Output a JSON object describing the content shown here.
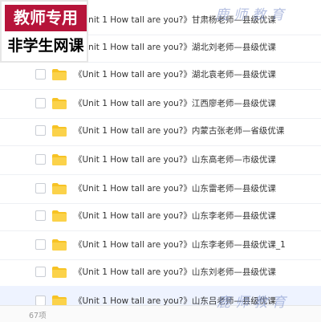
{
  "badge": {
    "line1": "教师专用",
    "line2": "非学生网课",
    "colors": {
      "top_bg": "#b6143a",
      "top_text": "#ffffff"
    }
  },
  "watermark": {
    "text": "鹿师教育"
  },
  "files": [
    {
      "name": "《Unit 1 How tall are you?》甘肃杨老师—县级优课",
      "icon": "folder-icon"
    },
    {
      "name": "《Unit 1 How tall are you?》湖北刘老师—县级优课",
      "icon": "folder-icon"
    },
    {
      "name": "《Unit 1 How tall are you?》湖北袁老师—县级优课",
      "icon": "folder-icon"
    },
    {
      "name": "《Unit 1 How tall are you?》江西廖老师—县级优课",
      "icon": "folder-icon"
    },
    {
      "name": "《Unit 1 How tall are you?》内蒙古张老师—省级优课",
      "icon": "folder-icon"
    },
    {
      "name": "《Unit 1 How tall are you?》山东高老师—市级优课",
      "icon": "folder-icon"
    },
    {
      "name": "《Unit 1 How tall are you?》山东雷老师—县级优课",
      "icon": "folder-icon"
    },
    {
      "name": "《Unit 1 How tall are you?》山东李老师—县级优课",
      "icon": "folder-icon"
    },
    {
      "name": "《Unit 1 How tall are you?》山东李老师—县级优课_1",
      "icon": "folder-icon"
    },
    {
      "name": "《Unit 1 How tall are you?》山东刘老师—县级优课",
      "icon": "folder-icon"
    },
    {
      "name": "《Unit 1 How tall are you?》山东吕老师—县级优课",
      "icon": "folder-icon"
    }
  ],
  "footer": {
    "count": "67项"
  },
  "colors": {
    "folder": "#f7c325",
    "row_highlight": "#eef3ff"
  }
}
